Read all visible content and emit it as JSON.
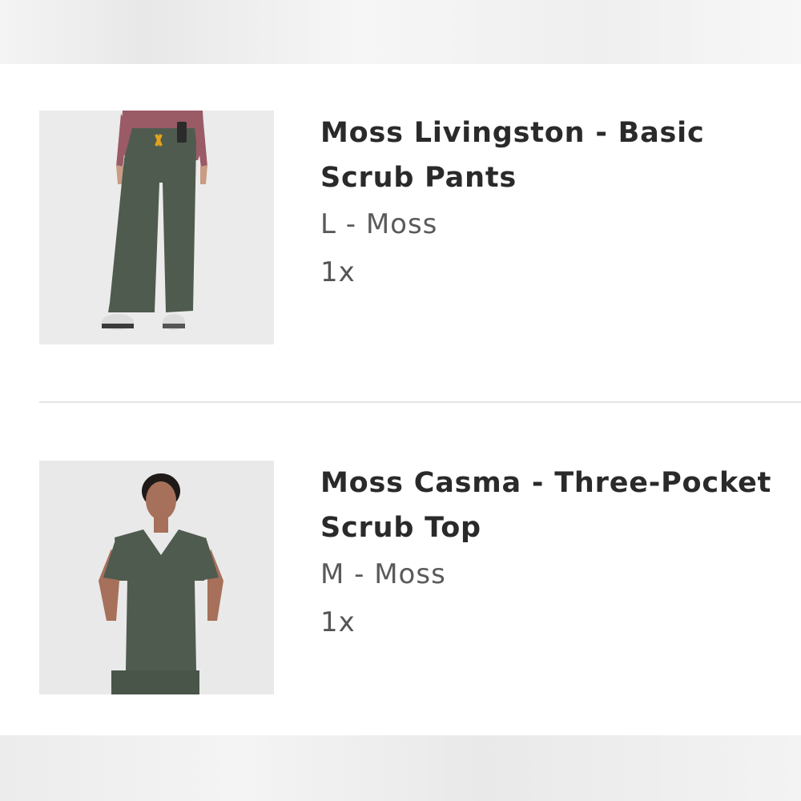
{
  "cart": {
    "items": [
      {
        "name": "Moss Livingston - Basic Scrub Pants",
        "variant": "L - Moss",
        "quantity": "1x",
        "image_alt": "pants-image"
      },
      {
        "name": "Moss Casma - Three-Pocket Scrub Top",
        "variant": "M - Moss",
        "quantity": "1x",
        "image_alt": "top-image"
      }
    ]
  },
  "colors": {
    "moss": "#4f5b4f",
    "background": "#ffffff",
    "thumb_bg": "#e9e9e9"
  }
}
